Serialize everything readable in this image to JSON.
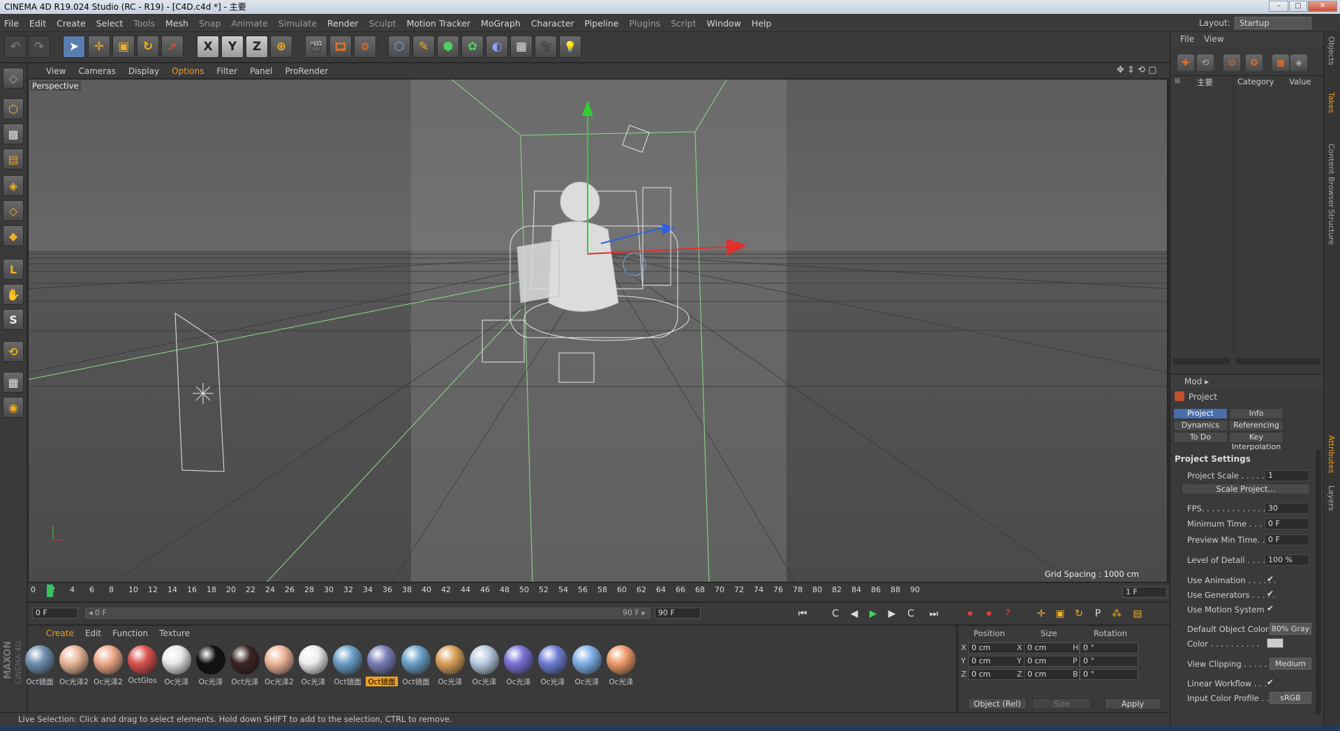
{
  "window": {
    "title": "CINEMA 4D R19.024 Studio (RC - R19) - [C4D.c4d *] - 主要",
    "min": "–",
    "max": "□",
    "close": "✕"
  },
  "menu": [
    "File",
    "Edit",
    "Create",
    "Select",
    "Tools",
    "Mesh",
    "Snap",
    "Animate",
    "Simulate",
    "Render",
    "Sculpt",
    "Motion Tracker",
    "MoGraph",
    "Character",
    "Pipeline",
    "Plugins",
    "Script",
    "Window",
    "Help"
  ],
  "menu_dim": [
    false,
    false,
    false,
    false,
    true,
    false,
    true,
    true,
    true,
    false,
    true,
    false,
    false,
    false,
    false,
    true,
    true,
    false,
    false
  ],
  "layout": {
    "label": "Layout:",
    "value": "Startup"
  },
  "toolbar": {
    "undo": "↶",
    "redo": "↷",
    "select": "➤",
    "move": "✛",
    "scale": "▣",
    "rotate": "↻",
    "live": "➚",
    "x": "X",
    "y": "Y",
    "z": "Z",
    "coord": "⊕",
    "render_view": "🎬",
    "render_pic": "🎞",
    "render_settings": "⚙",
    "cube": "⬡",
    "pen": "✎",
    "subdiv": "⬢",
    "cloner": "✿",
    "deformer": "◐",
    "floor": "▦",
    "camera": "🎥",
    "light": "💡"
  },
  "left_tools": {
    "make_editable": "◇",
    "model": "⬡",
    "texture": "▩",
    "workplane": "▤",
    "points": "◈",
    "edges": "◇",
    "polys": "◆",
    "axis": "L",
    "tweak": "✋",
    "snap_s": "S",
    "magnet": "⟲",
    "workplane_lock": "▦",
    "solo": "◉"
  },
  "viewport_menu": [
    "View",
    "Cameras",
    "Display",
    "Options",
    "Filter",
    "Panel",
    "ProRender"
  ],
  "viewport_menu_active": [
    false,
    false,
    false,
    true,
    false,
    false,
    false
  ],
  "viewport": {
    "label": "Perspective",
    "grid_spacing": "Grid Spacing : 1000 cm",
    "nav_icons": "✥ ⇕ ⟲ ▢"
  },
  "timeline": {
    "ticks": [
      "0",
      "2",
      "4",
      "6",
      "8",
      "10",
      "12",
      "14",
      "16",
      "18",
      "20",
      "22",
      "24",
      "26",
      "28",
      "30",
      "32",
      "34",
      "36",
      "38",
      "40",
      "42",
      "44",
      "46",
      "48",
      "50",
      "52",
      "54",
      "56",
      "58",
      "60",
      "62",
      "64",
      "66",
      "68",
      "70",
      "72",
      "74",
      "76",
      "78",
      "80",
      "82",
      "84",
      "86",
      "88",
      "90"
    ],
    "current": "1 F",
    "current_frame": 2
  },
  "playbar": {
    "start_field": "0 F",
    "range_start": "◂ 0 F",
    "range_end": "90 F ▸",
    "end_field": "90 F",
    "to_start": "⏮",
    "prev_key": "C",
    "prev_frame": "◀",
    "play": "▶",
    "next_frame": "▶",
    "next_key": "C",
    "to_end": "⏭",
    "rec": "⏺",
    "autokey": "⏺",
    "keyset": "?",
    "move_k": "✛",
    "scale_k": "▣",
    "rot_k": "↻",
    "param_k": "P",
    "pla_k": "⁂",
    "timeline_btn": "▤"
  },
  "materials": {
    "menu": [
      "Create",
      "Edit",
      "Function",
      "Texture"
    ],
    "menu_active": [
      true,
      false,
      false,
      false
    ],
    "items": [
      {
        "label": "Oct镜面",
        "color": "#6f8fb0",
        "pattern": true
      },
      {
        "label": "Oc光泽2",
        "color": "#e9b797"
      },
      {
        "label": "Oc光泽2",
        "color": "#f0a98a"
      },
      {
        "label": "OctGlos",
        "color": "#d9534f"
      },
      {
        "label": "Oc光泽",
        "color": "#e8e8e8"
      },
      {
        "label": "Oc光泽",
        "color": "#111111"
      },
      {
        "label": "Oct光泽",
        "color": "#3b2522"
      },
      {
        "label": "Oc光泽2",
        "color": "#eeb69a"
      },
      {
        "label": "Oc光泽",
        "color": "#ededed"
      },
      {
        "label": "Oct镜面",
        "color": "#6aa0c8",
        "pattern": true
      },
      {
        "label": "Oct镜面",
        "color": "#7a7fb8",
        "pattern": true,
        "selected": true
      },
      {
        "label": "Oct镜面",
        "color": "#6aa0c8",
        "pattern": true
      },
      {
        "label": "Oc光泽",
        "color": "#d9a05a",
        "pattern": true
      },
      {
        "label": "Oc光泽",
        "color": "#b9cbe0"
      },
      {
        "label": "Oc光泽",
        "color": "#7a72d8",
        "pattern": true
      },
      {
        "label": "Oc光泽",
        "color": "#6d7fd6",
        "pattern": true
      },
      {
        "label": "Oc光泽",
        "color": "#7fb0e8"
      },
      {
        "label": "Oc光泽",
        "color": "#ee9a6a"
      }
    ]
  },
  "coords": {
    "headers": [
      "Position",
      "Size",
      "Rotation"
    ],
    "rows": [
      {
        "a": "X",
        "pos": "0 cm",
        "b": "X",
        "size": "0 cm",
        "c": "H",
        "rot": "0 °"
      },
      {
        "a": "Y",
        "pos": "0 cm",
        "b": "Y",
        "size": "0 cm",
        "c": "P",
        "rot": "0 °"
      },
      {
        "a": "Z",
        "pos": "0 cm",
        "b": "Z",
        "size": "0 cm",
        "c": "B",
        "rot": "0 °"
      }
    ],
    "mode": "Object (Rel)",
    "size_mode": "Size",
    "apply": "Apply"
  },
  "status": "Live Selection: Click and drag to select elements. Hold down SHIFT to add to the selection, CTRL to remove.",
  "objects_panel": {
    "menu": [
      "File",
      "View"
    ],
    "tree_item": "主要",
    "columns": [
      "Category",
      "Value"
    ]
  },
  "attributes": {
    "mode": "Mod",
    "title": "Project",
    "tabs": [
      {
        "label": "Project Settings",
        "on": true
      },
      {
        "label": "Info"
      },
      {
        "label": "Dynamics"
      },
      {
        "label": "Referencing"
      },
      {
        "label": "To Do"
      },
      {
        "label": "Key Interpolation"
      }
    ],
    "section": "Project Settings",
    "project_scale_label": "Project Scale . . . . . .",
    "project_scale": "1",
    "scale_btn": "Scale Project...",
    "fps_label": "FPS. . . . . . . . . . . . . . .",
    "fps": "30",
    "min_time_label": "Minimum Time . . . . .",
    "min_time": "0 F",
    "preview_min_label": "Preview Min Time. . .",
    "preview_min": "0 F",
    "lod_label": "Level of Detail . . . . .",
    "lod": "100 %",
    "use_anim_label": "Use Animation . . . . . .",
    "use_gen_label": "Use Generators . . . . .",
    "use_motion_label": "Use Motion System",
    "check": "✔",
    "def_color_label": "Default Object Color",
    "def_color": "80% Gray",
    "color_label": "Color . . . . . . . . . .",
    "view_clip_label": "View Clipping . . . . .",
    "view_clip": "Medium",
    "linear_label": "Linear Workflow . . .",
    "icp_label": "Input Color Profile . .",
    "icp": "sRGB"
  },
  "side_tabs": [
    {
      "label": "Objects"
    },
    {
      "label": "Takes",
      "on": true
    },
    {
      "label": "Content Browser"
    },
    {
      "label": "Structure"
    },
    {
      "label": "Attributes",
      "on": true
    },
    {
      "label": "Layers"
    }
  ],
  "brand": {
    "maxon": "MAXON",
    "c4d": "CINEMA 4D"
  }
}
